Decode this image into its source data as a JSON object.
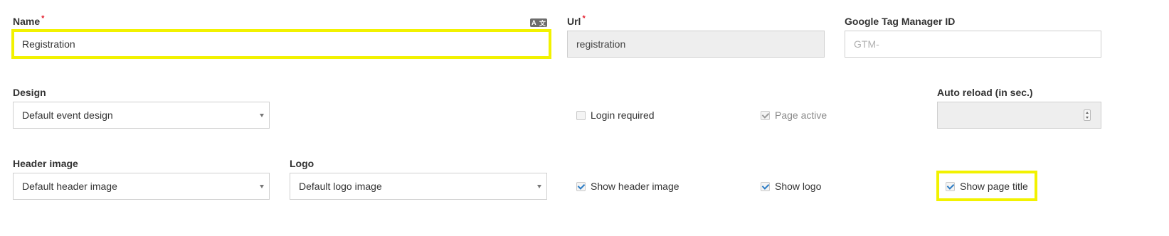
{
  "fields": {
    "name": {
      "label": "Name",
      "required_marker": "*",
      "value": "Registration"
    },
    "url": {
      "label": "Url",
      "required_marker": "*",
      "value": "registration"
    },
    "gtm": {
      "label": "Google Tag Manager ID",
      "placeholder": "GTM-"
    },
    "design": {
      "label": "Design",
      "value": "Default event design"
    },
    "auto_reload": {
      "label": "Auto reload (in sec.)",
      "value": ""
    },
    "header_image": {
      "label": "Header image",
      "value": "Default header image"
    },
    "logo": {
      "label": "Logo",
      "value": "Default logo image"
    }
  },
  "checkboxes": {
    "login_required": {
      "label": "Login required",
      "checked": false
    },
    "page_active": {
      "label": "Page active",
      "checked": true,
      "disabled": true
    },
    "show_header_image": {
      "label": "Show header image",
      "checked": true
    },
    "show_logo": {
      "label": "Show logo",
      "checked": true
    },
    "show_page_title": {
      "label": "Show page title",
      "checked": true
    }
  },
  "icons": {
    "translate": {
      "name": "translate-icon",
      "glyphs": [
        "A",
        "文"
      ]
    }
  },
  "colors": {
    "highlight": "#f2f200",
    "required": "#e4202f",
    "check": "#2a7bc4",
    "readonly_bg": "#eeeeee"
  }
}
